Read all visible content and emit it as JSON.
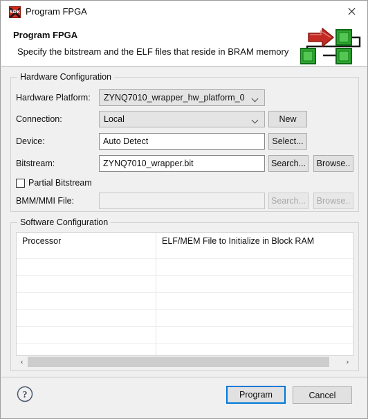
{
  "window": {
    "title": "Program FPGA",
    "icon": "sdk-icon",
    "close_icon": "close-icon"
  },
  "header": {
    "title": "Program FPGA",
    "description": "Specify the bitstream and the ELF files that reside in BRAM memory",
    "graphic": "fpga-flow-diagram-icon"
  },
  "hardware_configuration": {
    "group_title": "Hardware Configuration",
    "hardware_platform": {
      "label": "Hardware Platform:",
      "value": "ZYNQ7010_wrapper_hw_platform_0"
    },
    "connection": {
      "label": "Connection:",
      "value": "Local",
      "new_button": "New"
    },
    "device": {
      "label": "Device:",
      "value": "Auto Detect",
      "select_button": "Select..."
    },
    "bitstream": {
      "label": "Bitstream:",
      "value": "ZYNQ7010_wrapper.bit",
      "search_button": "Search...",
      "browse_button": "Browse.."
    },
    "partial_bitstream": {
      "label": "Partial Bitstream",
      "checked": false
    },
    "bmm_mmi": {
      "label": "BMM/MMI File:",
      "value": "",
      "search_button": "Search...",
      "browse_button": "Browse..",
      "disabled": true
    }
  },
  "software_configuration": {
    "group_title": "Software Configuration",
    "table": {
      "columns": [
        "Processor",
        "ELF/MEM File to Initialize in Block RAM"
      ],
      "rows": [
        [
          "",
          ""
        ],
        [
          "",
          ""
        ],
        [
          "",
          ""
        ],
        [
          "",
          ""
        ],
        [
          "",
          ""
        ],
        [
          "",
          ""
        ]
      ]
    },
    "scrollbar": {
      "left_arrow": "‹",
      "right_arrow": "›"
    }
  },
  "footer": {
    "help_icon": "help-icon",
    "program_button": "Program",
    "cancel_button": "Cancel"
  },
  "colors": {
    "accent": "#0078d7",
    "dialog_background": "#f0f0f0",
    "header_background": "#ffffff",
    "icon_red": "#d42a1c",
    "icon_green": "#1a8a1a"
  }
}
